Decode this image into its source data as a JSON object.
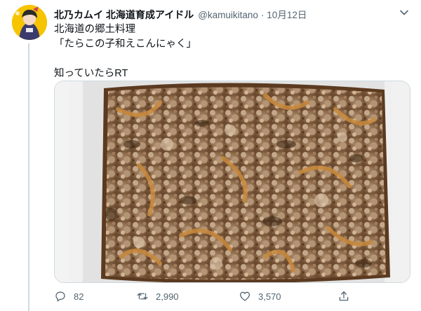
{
  "tweet": {
    "display_name": "北乃カムイ 北海道育成アイドル",
    "handle": "@kamuikitano",
    "separator": "·",
    "timestamp": "10月12日",
    "text_lines": [
      "北海道の郷土料理",
      "「たらこの子和えこんにゃく」",
      "",
      "知っていたらRT"
    ]
  },
  "actions": {
    "reply_count": "82",
    "retweet_count": "2,990",
    "like_count": "3,570"
  },
  "colors": {
    "text_primary": "#0f1419",
    "text_secondary": "#536471",
    "divider": "#cfd9de",
    "avatar_bg": "#f6c400"
  },
  "icons": [
    "avatar",
    "chevron-down-icon",
    "reply-icon",
    "retweet-icon",
    "like-icon",
    "share-icon"
  ]
}
